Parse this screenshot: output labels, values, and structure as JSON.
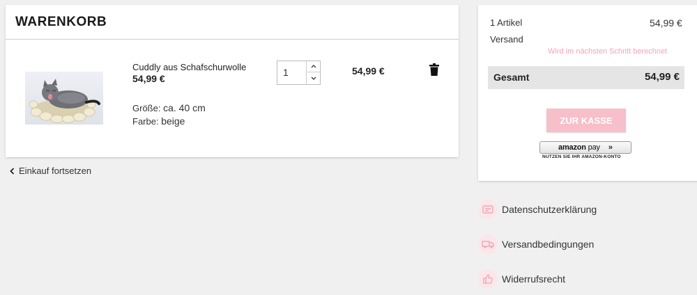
{
  "cart": {
    "title": "WARENKORB",
    "item": {
      "name": "Cuddly aus Schafschurwolle",
      "unit_price": "54,99 €",
      "size_label": "Größe:",
      "size_value": "ca. 40 cm",
      "color_label": "Farbe:",
      "color_value": "beige",
      "quantity": "1",
      "line_total": "54,99 €"
    },
    "continue_label": "Einkauf fortsetzen"
  },
  "summary": {
    "items_label": "1 Artikel",
    "items_value": "54,99 €",
    "shipping_label": "Versand",
    "shipping_note": "Wird im nächsten Schritt berechnet",
    "total_label": "Gesamt",
    "total_value": "54,99 €",
    "checkout_label": "ZUR KASSE",
    "amazon_logo_text": "amazon",
    "amazon_pay_text": "pay",
    "amazon_arrows": "»",
    "amazon_sub": "NUTZEN SIE IHR AMAZON-KONTO"
  },
  "info_links": [
    {
      "label": "Datenschutzerklärung",
      "icon": "privacy-icon"
    },
    {
      "label": "Versandbedingungen",
      "icon": "truck-icon"
    },
    {
      "label": "Widerrufsrecht",
      "icon": "thumbs-up-icon"
    }
  ],
  "colors": {
    "accent_pink": "#f7bfca",
    "note_pink": "#f3a4b4",
    "icon_bg": "#fbe6ea",
    "background": "#f0f0f0"
  }
}
